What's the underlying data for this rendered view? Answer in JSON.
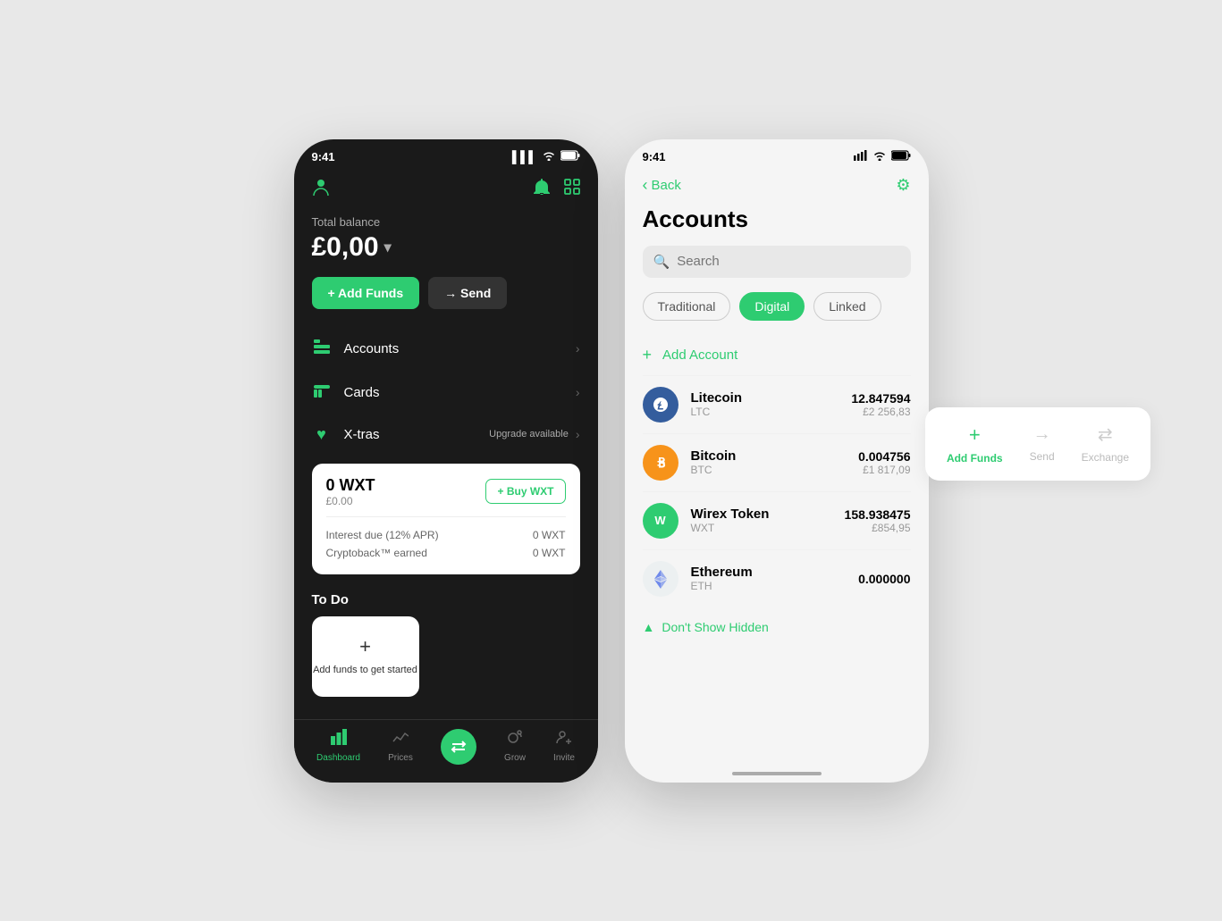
{
  "background": "#e8e8e8",
  "phone_dark": {
    "status_bar": {
      "time": "9:41",
      "signal": "▌▌▌",
      "wifi": "wifi",
      "battery": "battery"
    },
    "balance_label": "Total balance",
    "balance_amount": "£0,00",
    "btn_add_funds": "+ Add Funds",
    "btn_send": "→ Send",
    "menu_items": [
      {
        "icon": "accounts",
        "label": "Accounts"
      },
      {
        "icon": "cards",
        "label": "Cards"
      }
    ],
    "xtras_label": "X-tras",
    "upgrade_label": "Upgrade available",
    "wxt_amount": "0 WXT",
    "wxt_gbp": "£0.00",
    "btn_buy_wxt": "+ Buy WXT",
    "interest_label": "Interest due (12% APR)",
    "interest_value": "0 WXT",
    "cryptoback_label": "Cryptoback™ earned",
    "cryptoback_value": "0 WXT",
    "todo_title": "To Do",
    "todo_card_text": "Add funds to get started",
    "nav_items": [
      {
        "label": "Dashboard",
        "active": true
      },
      {
        "label": "Prices",
        "active": false
      },
      {
        "label": "",
        "active": false
      },
      {
        "label": "Grow",
        "active": false
      },
      {
        "label": "Invite",
        "active": false
      }
    ]
  },
  "phone_light": {
    "status_bar": {
      "time": "9:41"
    },
    "back_label": "Back",
    "page_title": "Accounts",
    "search_placeholder": "Search",
    "filter_tabs": [
      {
        "label": "Traditional",
        "active": false
      },
      {
        "label": "Digital",
        "active": true
      },
      {
        "label": "Linked",
        "active": false
      }
    ],
    "add_account_label": "Add Account",
    "coins": [
      {
        "icon": "L",
        "icon_class": "ltc",
        "name": "Litecoin",
        "ticker": "LTC",
        "crypto_amount": "12.847594",
        "fiat_amount": "£2 256,83"
      },
      {
        "icon": "₿",
        "icon_class": "btc",
        "name": "Bitcoin",
        "ticker": "BTC",
        "crypto_amount": "0.004756",
        "fiat_amount": "£1 817,09"
      },
      {
        "icon": "W",
        "icon_class": "wxt",
        "name": "Wirex Token",
        "ticker": "WXT",
        "crypto_amount": "158.938475",
        "fiat_amount": "£854,95"
      },
      {
        "icon": "◆",
        "icon_class": "eth",
        "name": "Ethereum",
        "ticker": "ETH",
        "crypto_amount": "0.000000",
        "fiat_amount": ""
      }
    ],
    "hidden_label": "Don't Show Hidden"
  },
  "right_card": {
    "items": [
      {
        "icon": "+",
        "label": "Add Funds",
        "active": true
      },
      {
        "icon": "→",
        "label": "Send",
        "active": false
      },
      {
        "icon": "⇄",
        "label": "Exchange",
        "active": false
      }
    ]
  }
}
